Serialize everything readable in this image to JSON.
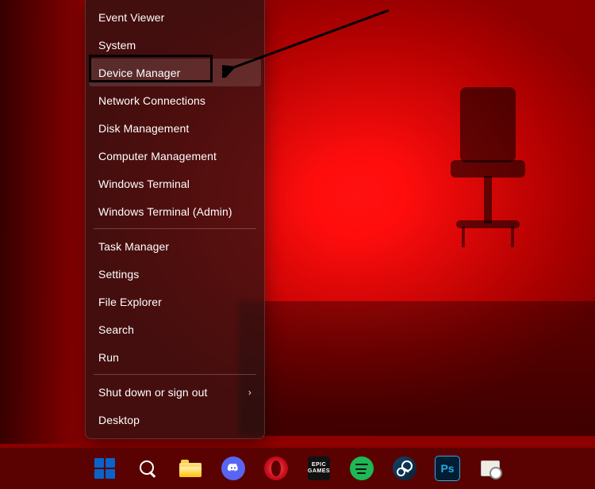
{
  "winx_menu": {
    "groups": [
      [
        {
          "id": "event-viewer",
          "label": "Event Viewer",
          "submenu": false
        },
        {
          "id": "system",
          "label": "System",
          "submenu": false
        },
        {
          "id": "device-manager",
          "label": "Device Manager",
          "submenu": false,
          "highlighted": true,
          "hover": true
        },
        {
          "id": "network-connections",
          "label": "Network Connections",
          "submenu": false
        },
        {
          "id": "disk-management",
          "label": "Disk Management",
          "submenu": false
        },
        {
          "id": "computer-management",
          "label": "Computer Management",
          "submenu": false
        },
        {
          "id": "windows-terminal",
          "label": "Windows Terminal",
          "submenu": false
        },
        {
          "id": "windows-terminal-admin",
          "label": "Windows Terminal (Admin)",
          "submenu": false
        }
      ],
      [
        {
          "id": "task-manager",
          "label": "Task Manager",
          "submenu": false
        },
        {
          "id": "settings",
          "label": "Settings",
          "submenu": false
        },
        {
          "id": "file-explorer",
          "label": "File Explorer",
          "submenu": false
        },
        {
          "id": "search",
          "label": "Search",
          "submenu": false
        },
        {
          "id": "run",
          "label": "Run",
          "submenu": false
        }
      ],
      [
        {
          "id": "shut-down-or-sign-out",
          "label": "Shut down or sign out",
          "submenu": true
        },
        {
          "id": "desktop",
          "label": "Desktop",
          "submenu": false
        }
      ]
    ]
  },
  "taskbar": {
    "items": [
      {
        "id": "start",
        "name": "start-button",
        "icon": "windows-logo-icon"
      },
      {
        "id": "search",
        "name": "taskbar-search",
        "icon": "search-icon"
      },
      {
        "id": "explorer",
        "name": "taskbar-file-explorer",
        "icon": "file-explorer-icon"
      },
      {
        "id": "discord",
        "name": "taskbar-discord",
        "icon": "discord-icon"
      },
      {
        "id": "opera",
        "name": "taskbar-opera",
        "icon": "opera-icon"
      },
      {
        "id": "epic",
        "name": "taskbar-epic-games",
        "icon": "epic-games-icon",
        "label_line1": "EPIC",
        "label_line2": "GAMES"
      },
      {
        "id": "spotify",
        "name": "taskbar-spotify",
        "icon": "spotify-icon"
      },
      {
        "id": "steam",
        "name": "taskbar-steam",
        "icon": "steam-icon"
      },
      {
        "id": "photoshop",
        "name": "taskbar-photoshop",
        "icon": "photoshop-icon",
        "label": "Ps"
      },
      {
        "id": "device",
        "name": "taskbar-device-app",
        "icon": "device-app-icon"
      }
    ]
  },
  "annotation": {
    "target": "device-manager",
    "style": "arrow-and-box"
  }
}
